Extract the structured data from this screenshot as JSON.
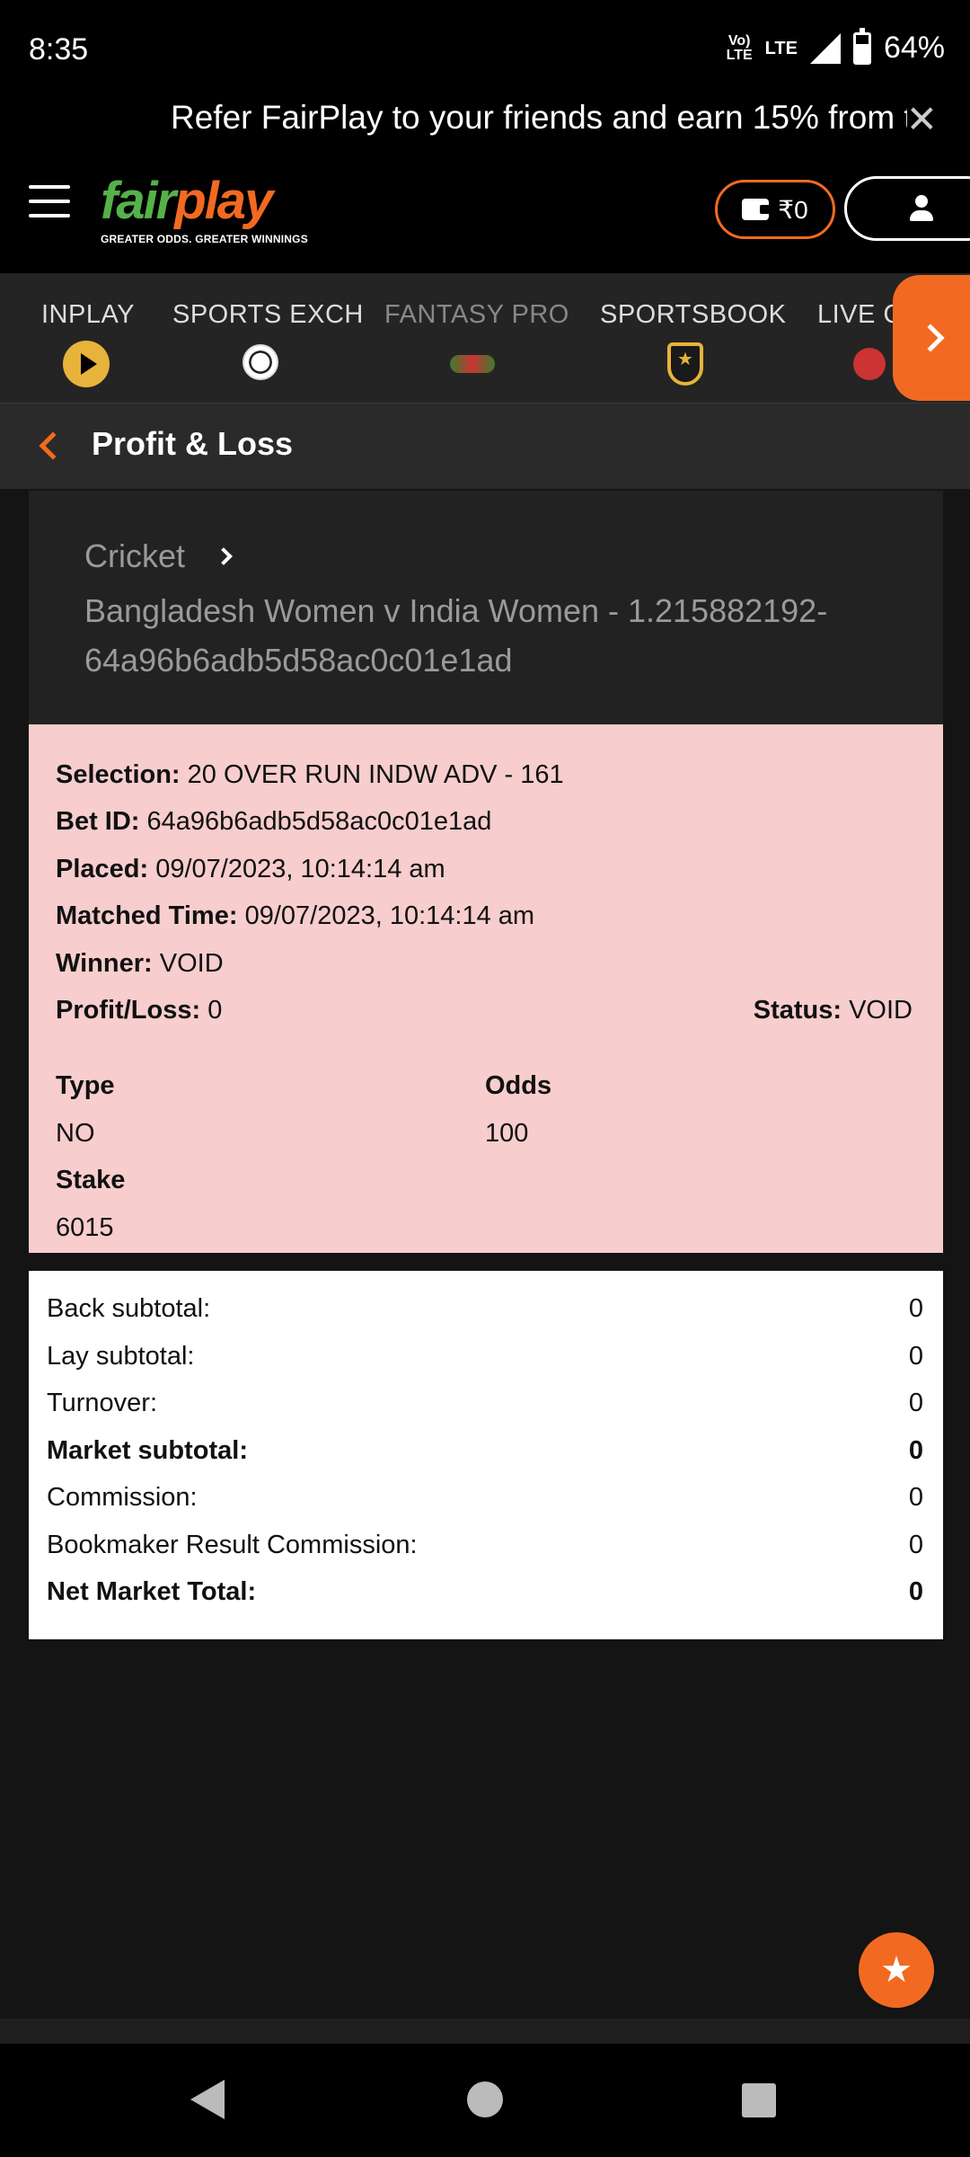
{
  "status_bar": {
    "time": "8:35",
    "volte": "Vo)) LTE",
    "network": "LTE",
    "battery_percent": "64%",
    "battery_level": 0.64
  },
  "banner": {
    "text": "Refer FairPlay to your friends and earn 15% from th",
    "close_symbol": "✕"
  },
  "header": {
    "logo_fair": "fair",
    "logo_play": "play",
    "logo_tagline": "GREATER ODDS. GREATER WINNINGS",
    "wallet_balance": "₹0"
  },
  "categories": [
    {
      "label": "INPLAY",
      "icon": "play-icon"
    },
    {
      "label": "SPORTS EXCH",
      "icon": "soccer-ball-icon"
    },
    {
      "label": "FANTASY PRO",
      "icon": "fantasy-icon"
    },
    {
      "label": "SPORTSBOOK",
      "icon": "shield-star-icon"
    },
    {
      "label": "LIVE C",
      "icon": "live-casino-icon"
    }
  ],
  "page": {
    "title": "Profit & Loss"
  },
  "event": {
    "sport": "Cricket",
    "title": "Bangladesh Women v India Women - 1.215882192-64a96b6adb5d58ac0c01e1ad"
  },
  "bet": {
    "selection_label": "Selection:",
    "selection": "20 OVER RUN INDW ADV - 161",
    "bet_id_label": "Bet ID:",
    "bet_id": "64a96b6adb5d58ac0c01e1ad",
    "placed_label": "Placed:",
    "placed": "09/07/2023, 10:14:14 am",
    "matched_label": "Matched Time:",
    "matched": "09/07/2023, 10:14:14 am",
    "winner_label": "Winner:",
    "winner": "VOID",
    "pl_label": "Profit/Loss:",
    "pl": "0",
    "status_label": "Status:",
    "status": "VOID",
    "type_label": "Type",
    "type": "NO",
    "odds_label": "Odds",
    "odds": "100",
    "stake_label": "Stake",
    "stake": "6015"
  },
  "totals": [
    {
      "label": "Back subtotal:",
      "value": "0",
      "bold": false
    },
    {
      "label": "Lay subtotal:",
      "value": "0",
      "bold": false
    },
    {
      "label": "Turnover:",
      "value": "0",
      "bold": false
    },
    {
      "label": "Market subtotal:",
      "value": "0",
      "bold": true
    },
    {
      "label": "Commission:",
      "value": "0",
      "bold": false
    },
    {
      "label": "Bookmaker Result Commission:",
      "value": "0",
      "bold": false
    },
    {
      "label": "Net Market Total:",
      "value": "0",
      "bold": true
    }
  ],
  "colors": {
    "accent": "#f26a21",
    "brand_green": "#55b14a",
    "bet_card_bg": "#f7cdcd"
  }
}
